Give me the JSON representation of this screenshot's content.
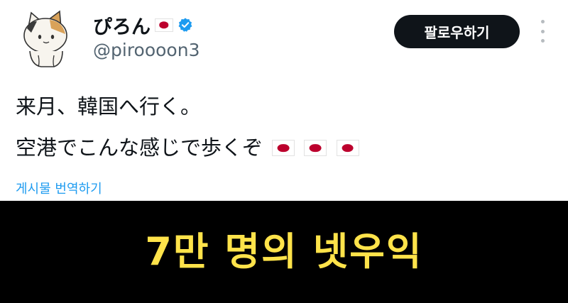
{
  "profile": {
    "display_name": "ぴろん",
    "display_name_flag_icon": "japan-flag-icon",
    "verified_icon": "verified-badge-icon",
    "handle": "@piroooon3",
    "avatar_icon": "calico-cat-avatar"
  },
  "header": {
    "follow_label": "팔로우하기",
    "more_icon": "more-vertical-icon"
  },
  "tweet": {
    "line1": "来月、韓国へ行く。",
    "line2": "空港でこんな感じで歩くぞ",
    "line2_flags": [
      "japan-flag-icon",
      "japan-flag-icon",
      "japan-flag-icon"
    ],
    "translate_label": "게시물 번역하기"
  },
  "caption": {
    "text": "7만 명의 넷우익"
  },
  "colors": {
    "name": "#0f1419",
    "handle": "#536471",
    "verified": "#1d9bf0",
    "link": "#1d9bf0",
    "button_bg": "#0f1419",
    "caption_bg": "#000000",
    "caption_text": "#ffe34a",
    "flag_red": "#bc002d"
  }
}
